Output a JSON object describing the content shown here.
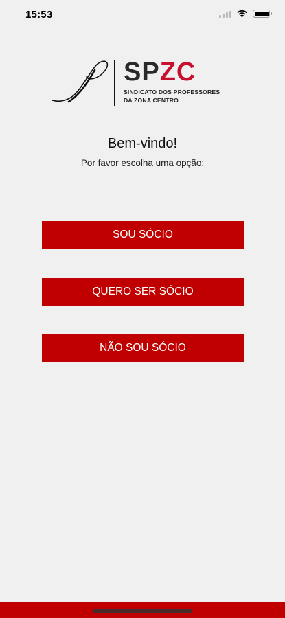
{
  "status_bar": {
    "time": "15:53",
    "icons": [
      "signal-icon",
      "wifi-icon",
      "battery-icon"
    ]
  },
  "logo": {
    "acronym_dark": "SP",
    "acronym_red": "ZC",
    "subtitle_line1": "SINDICATO DOS PROFESSORES",
    "subtitle_line2": "DA ZONA CENTRO"
  },
  "welcome": {
    "title": "Bem-vindo!",
    "subtitle": "Por favor escolha uma opção:"
  },
  "options": [
    {
      "label": "SOU SÓCIO"
    },
    {
      "label": "QUERO SER SÓCIO"
    },
    {
      "label": "NÃO SOU SÓCIO"
    }
  ],
  "colors": {
    "brand_red": "#c00000",
    "background": "#f0f0f0"
  }
}
